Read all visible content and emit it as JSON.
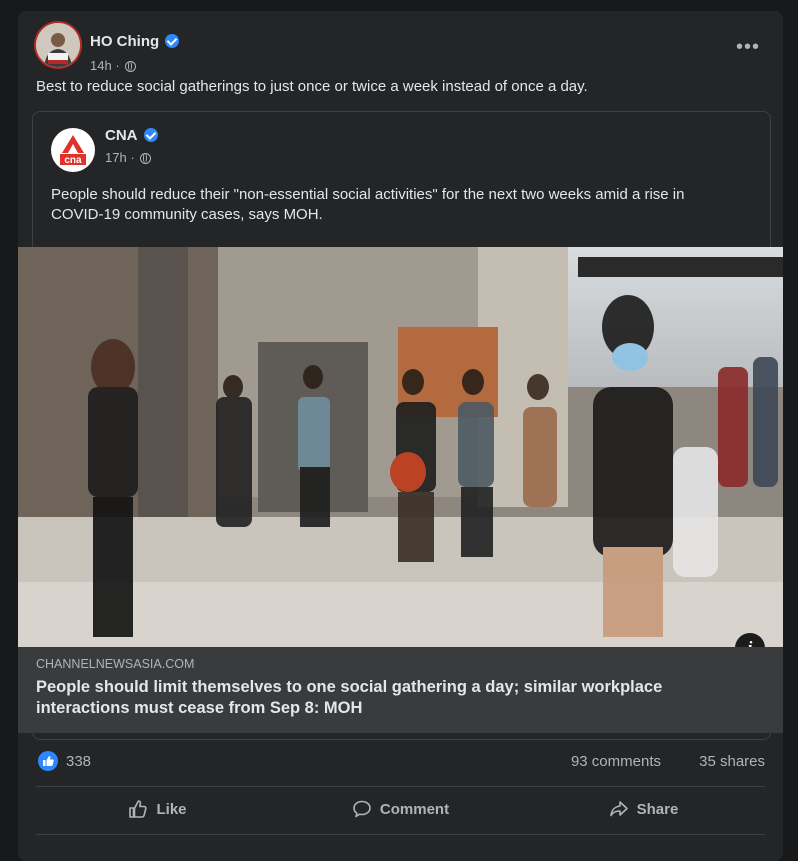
{
  "post": {
    "author": "HO Ching",
    "time": "14h",
    "text": "Best to reduce social gatherings to just once or twice a week instead of once a day.",
    "more_icon": "more-horizontal-icon"
  },
  "shared": {
    "author": "CNA",
    "time": "17h",
    "logo_text": "cna",
    "text": "People should reduce their \"non-essential social activities\" for the next two weeks amid a rise in COVID-19 community cases, says MOH."
  },
  "link": {
    "domain": "CHANNELNEWSASIA.COM",
    "title": "People should limit themselves to one social gathering a day; similar workplace interactions must cease from Sep 8: MOH",
    "info_label": "i"
  },
  "stats": {
    "likes": "338",
    "comments": "93 comments",
    "shares": "35 shares"
  },
  "actions": {
    "like": "Like",
    "comment": "Comment",
    "share": "Share"
  },
  "colors": {
    "background": "#18191a",
    "card": "#242526",
    "accent_blue": "#2d88ff",
    "cna_red": "#e0322b"
  }
}
